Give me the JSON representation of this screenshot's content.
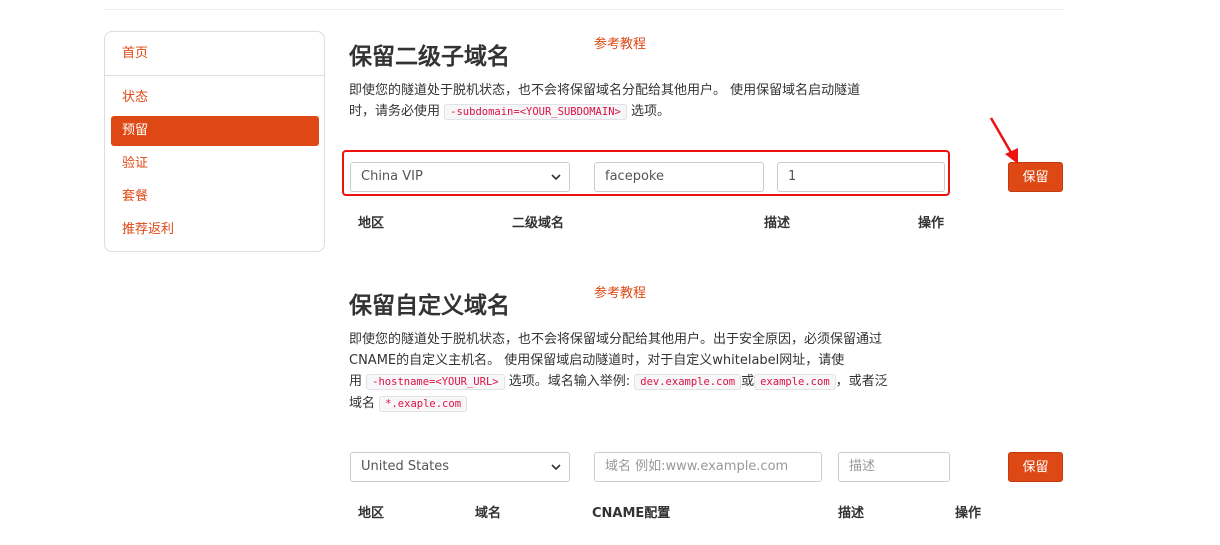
{
  "sidebar": {
    "home": "首页",
    "items": [
      {
        "label": "状态"
      },
      {
        "label": "预留"
      },
      {
        "label": "验证"
      },
      {
        "label": "套餐"
      },
      {
        "label": "推荐返利"
      }
    ]
  },
  "subdomain_section": {
    "title": "保留二级子域名",
    "ref_link": "参考教程",
    "desc_line1": "即使您的隧道处于脱机状态，也不会将保留域名分配给其他用户。 使用保留域名启动隧道",
    "desc_line2_prefix": "时，请务必使用",
    "desc_code": "-subdomain=<YOUR_SUBDOMAIN>",
    "desc_line2_suffix": "选项。",
    "region_value": "China VIP",
    "subdomain_value": "facepoke",
    "description_value": "1",
    "save_label": "保留",
    "columns": [
      "地区",
      "二级域名",
      "描述",
      "操作"
    ]
  },
  "custom_section": {
    "title": "保留自定义域名",
    "ref_link": "参考教程",
    "desc_line1": "即使您的隧道处于脱机状态，也不会将保留域分配给其他用户。出于安全原因，必须保留通过",
    "desc_line2": "CNAME的自定义主机名。 使用保留域启动隧道时，对于自定义whitelabel网址，请使",
    "desc_line3_prefix": "用",
    "desc_code1": "-hostname=<YOUR_URL>",
    "desc_line3_mid": "选项。域名输入举例:",
    "desc_code2": "dev.example.com",
    "desc_line3_or": "或",
    "desc_code3": "example.com",
    "desc_line3_suffix": "，或者泛",
    "desc_line4_prefix": "域名",
    "desc_code4": "*.exaple.com",
    "region_value": "United States",
    "domain_placeholder": "域名 例如:www.example.com",
    "description_placeholder": "描述",
    "save_label": "保留",
    "columns": [
      "地区",
      "域名",
      "CNAME配置",
      "描述",
      "操作"
    ]
  },
  "icons": {
    "select_chevron": "chevron-down-icon",
    "annotation_arrow": "red-arrow-icon"
  },
  "colors": {
    "accent": "#dd4814",
    "highlight": "#ee1111"
  }
}
